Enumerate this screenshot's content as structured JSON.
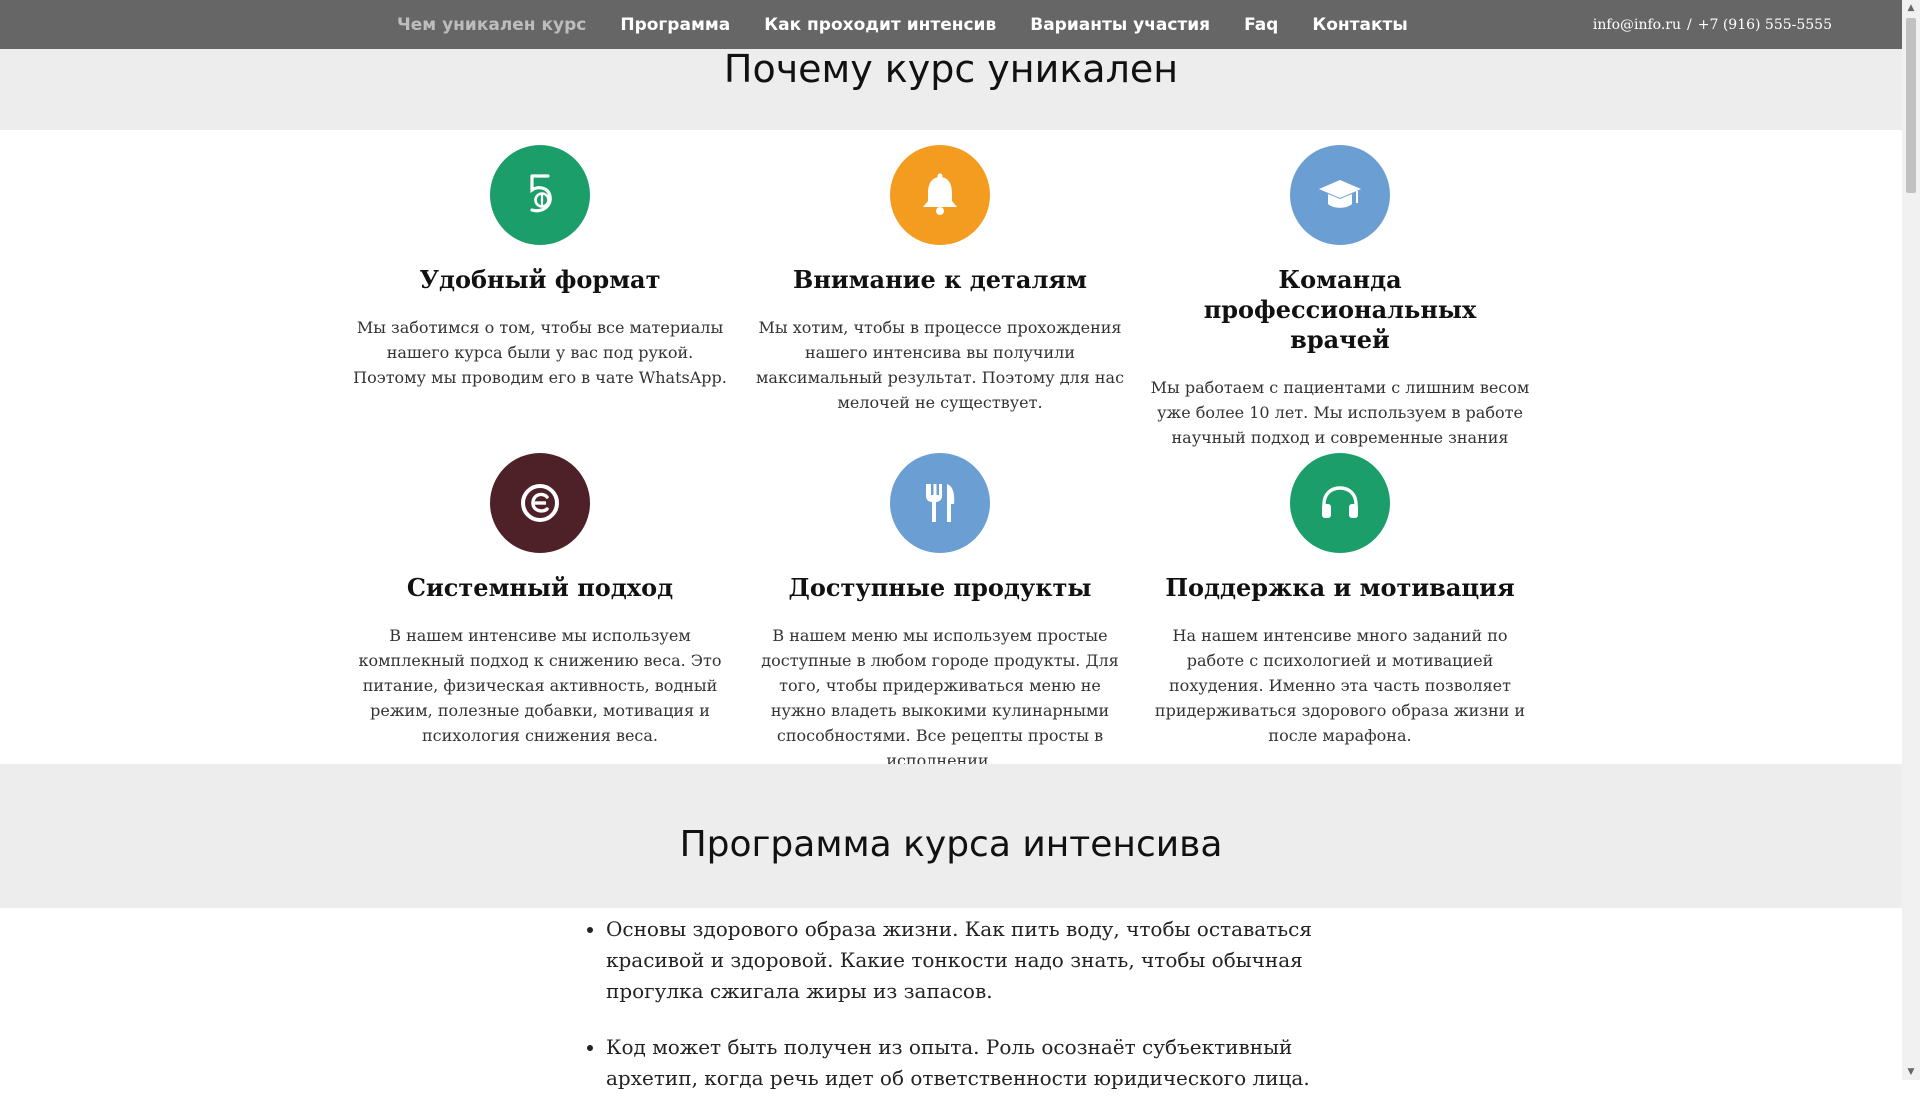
{
  "nav": {
    "items": [
      {
        "label": "Чем уникален курс",
        "active": true
      },
      {
        "label": "Программа"
      },
      {
        "label": "Как проходит интенсив"
      },
      {
        "label": "Варианты участия"
      },
      {
        "label": "Faq"
      },
      {
        "label": "Контакты"
      }
    ],
    "email": "info@info.ru",
    "separator": "/",
    "phone": "+7 (916) 555-5555"
  },
  "why": {
    "title": "Почему курс уникален",
    "features": [
      {
        "icon": "five-icon",
        "color": "#1b9e69",
        "title": "Удобный формат",
        "text": "Мы заботимся о том, чтобы все материалы нашего курса были у вас под рукой. Поэтому мы проводим его в чате WhatsApp."
      },
      {
        "icon": "bell-icon",
        "color": "#f39c1f",
        "title": "Внимание к деталям",
        "text": "Мы хотим, чтобы в процессе прохождения нашего интенсива вы получили максимальный результат. Поэтому для нас мелочей не существует."
      },
      {
        "icon": "graduation-cap-icon",
        "color": "#6b9fd4",
        "title": "Команда профессиональных врачей",
        "text": "Мы работаем с пациентами с лишним весом уже более 10 лет. Мы используем в работе научный подход и современные знания"
      },
      {
        "icon": "target-icon",
        "color": "#4e2129",
        "title": "Системный подход",
        "text": "В нашем интенсиве мы используем комплекный подход к снижению веса. Это питание, физическая активность, водный режим, полезные добавки, мотивация и психология снижения веса."
      },
      {
        "icon": "fork-knife-icon",
        "color": "#6b9fd4",
        "title": "Доступные продукты",
        "text": "В нашем меню мы используем простые доступные в любом городе продукты. Для того, чтобы придерживаться меню не нужно владеть выкокими кулинарными способностями. Все рецепты просты в исполнении."
      },
      {
        "icon": "headphones-icon",
        "color": "#1b9e69",
        "title": "Поддержка и мотивация",
        "text": "На нашем интенсиве много заданий по работе с психологией и мотивацией похудения. Именно эта часть позволяет придерживаться здорового образа жизни и после марафона."
      }
    ]
  },
  "program": {
    "title": "Программа курса интенсива",
    "items": [
      "Основы здорового образа жизни. Как пить воду, чтобы оставаться красивой и здоровой. Какие тонкости надо знать, чтобы обычная прогулка сжигала жиры из запасов.",
      "Код может быть получен из опыта. Роль осознаёт субъективный архетип, когда речь идет об ответственности юридического лица."
    ]
  }
}
